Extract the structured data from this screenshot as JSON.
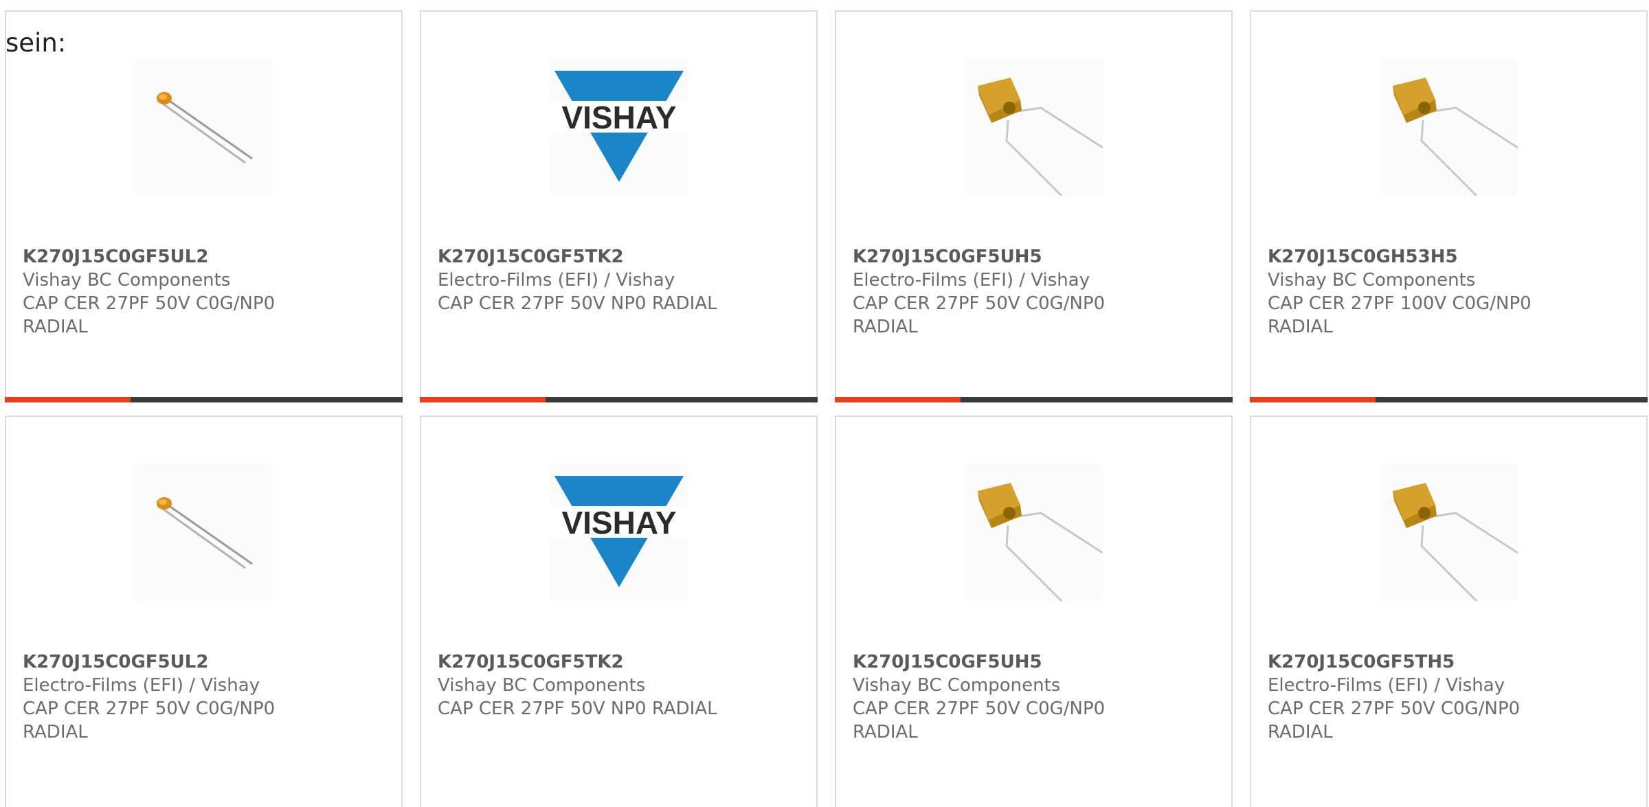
{
  "intro_text": "sein:",
  "accent_color": "#e8401c",
  "bar_color": "#3b3b3b",
  "cards": [
    {
      "part_number": "K270J15C0GF5UL2",
      "manufacturer": "Vishay BC Components",
      "desc_line1": "CAP CER 27PF 50V C0G/NP0",
      "desc_line2": "RADIAL",
      "image": "small-disc-capacitor"
    },
    {
      "part_number": "K270J15C0GF5TK2",
      "manufacturer": "Electro-Films (EFI) / Vishay",
      "desc_line1": "CAP CER 27PF 50V NP0 RADIAL",
      "desc_line2": "",
      "image": "vishay-logo",
      "logo_text": "VISHAY"
    },
    {
      "part_number": "K270J15C0GF5UH5",
      "manufacturer": "Electro-Films (EFI) / Vishay",
      "desc_line1": "CAP CER 27PF 50V C0G/NP0",
      "desc_line2": "RADIAL",
      "image": "yellow-block-capacitor"
    },
    {
      "part_number": "K270J15C0GH53H5",
      "manufacturer": "Vishay BC Components",
      "desc_line1": "CAP CER 27PF 100V C0G/NP0",
      "desc_line2": "RADIAL",
      "image": "yellow-block-capacitor"
    },
    {
      "part_number": "K270J15C0GF5UL2",
      "manufacturer": "Electro-Films (EFI) / Vishay",
      "desc_line1": "CAP CER 27PF 50V C0G/NP0",
      "desc_line2": "RADIAL",
      "image": "small-disc-capacitor"
    },
    {
      "part_number": "K270J15C0GF5TK2",
      "manufacturer": "Vishay BC Components",
      "desc_line1": "CAP CER 27PF 50V NP0 RADIAL",
      "desc_line2": "",
      "image": "vishay-logo",
      "logo_text": "VISHAY"
    },
    {
      "part_number": "K270J15C0GF5UH5",
      "manufacturer": "Vishay BC Components",
      "desc_line1": "CAP CER 27PF 50V C0G/NP0",
      "desc_line2": "RADIAL",
      "image": "yellow-block-capacitor"
    },
    {
      "part_number": "K270J15C0GF5TH5",
      "manufacturer": "Electro-Films (EFI) / Vishay",
      "desc_line1": "CAP CER 27PF 50V C0G/NP0",
      "desc_line2": "RADIAL",
      "image": "yellow-block-capacitor"
    }
  ]
}
